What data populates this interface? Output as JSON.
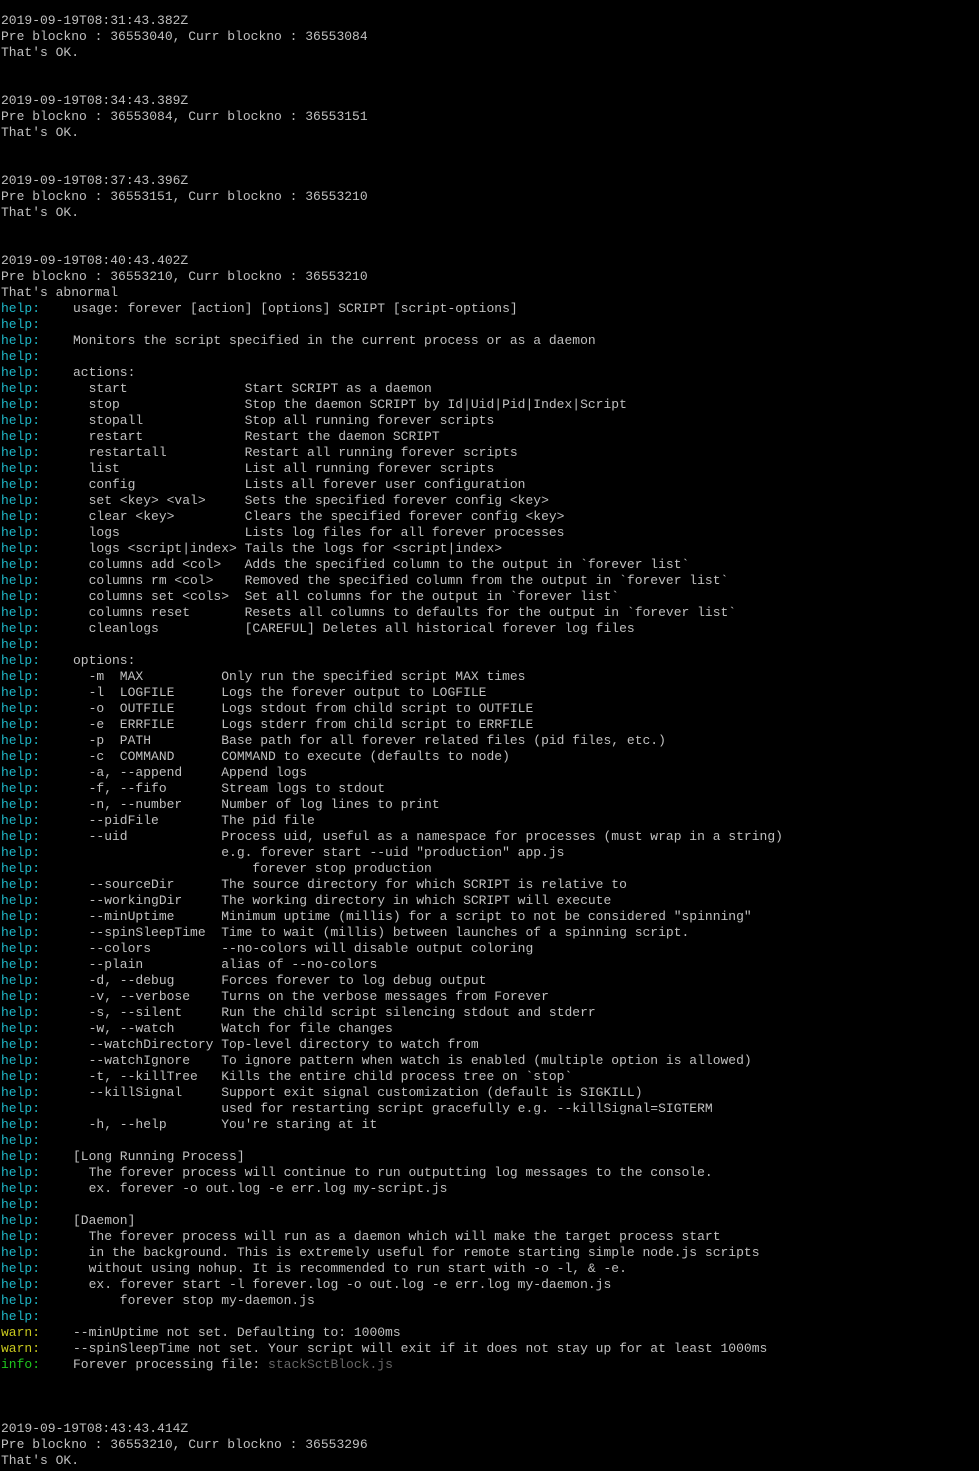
{
  "colors": {
    "background": "#000000",
    "text": "#c0c0c0",
    "help_prefix": "#1eb8c8",
    "warn_prefix": "#c8c81e",
    "info_prefix": "#1ec81e",
    "dim_filename": "#666666"
  },
  "lines": [
    {
      "t": "2019-09-19T08:31:43.382Z"
    },
    {
      "t": "Pre blockno : 36553040, Curr blockno : 36553084"
    },
    {
      "t": "That's OK."
    },
    {
      "t": ""
    },
    {
      "t": ""
    },
    {
      "t": "2019-09-19T08:34:43.389Z"
    },
    {
      "t": "Pre blockno : 36553084, Curr blockno : 36553151"
    },
    {
      "t": "That's OK."
    },
    {
      "t": ""
    },
    {
      "t": ""
    },
    {
      "t": "2019-09-19T08:37:43.396Z"
    },
    {
      "t": "Pre blockno : 36553151, Curr blockno : 36553210"
    },
    {
      "t": "That's OK."
    },
    {
      "t": ""
    },
    {
      "t": ""
    },
    {
      "t": "2019-09-19T08:40:43.402Z"
    },
    {
      "t": "Pre blockno : 36553210, Curr blockno : 36553210"
    },
    {
      "t": "That's abnormal"
    },
    {
      "p": "help:",
      "t": "usage: forever [action] [options] SCRIPT [script-options]"
    },
    {
      "p": "help:",
      "t": ""
    },
    {
      "p": "help:",
      "t": "Monitors the script specified in the current process or as a daemon"
    },
    {
      "p": "help:",
      "t": ""
    },
    {
      "p": "help:",
      "t": "actions:"
    },
    {
      "p": "help:",
      "t": "  start               Start SCRIPT as a daemon"
    },
    {
      "p": "help:",
      "t": "  stop                Stop the daemon SCRIPT by Id|Uid|Pid|Index|Script"
    },
    {
      "p": "help:",
      "t": "  stopall             Stop all running forever scripts"
    },
    {
      "p": "help:",
      "t": "  restart             Restart the daemon SCRIPT"
    },
    {
      "p": "help:",
      "t": "  restartall          Restart all running forever scripts"
    },
    {
      "p": "help:",
      "t": "  list                List all running forever scripts"
    },
    {
      "p": "help:",
      "t": "  config              Lists all forever user configuration"
    },
    {
      "p": "help:",
      "t": "  set <key> <val>     Sets the specified forever config <key>"
    },
    {
      "p": "help:",
      "t": "  clear <key>         Clears the specified forever config <key>"
    },
    {
      "p": "help:",
      "t": "  logs                Lists log files for all forever processes"
    },
    {
      "p": "help:",
      "t": "  logs <script|index> Tails the logs for <script|index>"
    },
    {
      "p": "help:",
      "t": "  columns add <col>   Adds the specified column to the output in `forever list`"
    },
    {
      "p": "help:",
      "t": "  columns rm <col>    Removed the specified column from the output in `forever list`"
    },
    {
      "p": "help:",
      "t": "  columns set <cols>  Set all columns for the output in `forever list`"
    },
    {
      "p": "help:",
      "t": "  columns reset       Resets all columns to defaults for the output in `forever list`"
    },
    {
      "p": "help:",
      "t": "  cleanlogs           [CAREFUL] Deletes all historical forever log files"
    },
    {
      "p": "help:",
      "t": ""
    },
    {
      "p": "help:",
      "t": "options:"
    },
    {
      "p": "help:",
      "t": "  -m  MAX          Only run the specified script MAX times"
    },
    {
      "p": "help:",
      "t": "  -l  LOGFILE      Logs the forever output to LOGFILE"
    },
    {
      "p": "help:",
      "t": "  -o  OUTFILE      Logs stdout from child script to OUTFILE"
    },
    {
      "p": "help:",
      "t": "  -e  ERRFILE      Logs stderr from child script to ERRFILE"
    },
    {
      "p": "help:",
      "t": "  -p  PATH         Base path for all forever related files (pid files, etc.)"
    },
    {
      "p": "help:",
      "t": "  -c  COMMAND      COMMAND to execute (defaults to node)"
    },
    {
      "p": "help:",
      "t": "  -a, --append     Append logs"
    },
    {
      "p": "help:",
      "t": "  -f, --fifo       Stream logs to stdout"
    },
    {
      "p": "help:",
      "t": "  -n, --number     Number of log lines to print"
    },
    {
      "p": "help:",
      "t": "  --pidFile        The pid file"
    },
    {
      "p": "help:",
      "t": "  --uid            Process uid, useful as a namespace for processes (must wrap in a string)"
    },
    {
      "p": "help:",
      "t": "                   e.g. forever start --uid \"production\" app.js"
    },
    {
      "p": "help:",
      "t": "                       forever stop production"
    },
    {
      "p": "help:",
      "t": "  --sourceDir      The source directory for which SCRIPT is relative to"
    },
    {
      "p": "help:",
      "t": "  --workingDir     The working directory in which SCRIPT will execute"
    },
    {
      "p": "help:",
      "t": "  --minUptime      Minimum uptime (millis) for a script to not be considered \"spinning\""
    },
    {
      "p": "help:",
      "t": "  --spinSleepTime  Time to wait (millis) between launches of a spinning script."
    },
    {
      "p": "help:",
      "t": "  --colors         --no-colors will disable output coloring"
    },
    {
      "p": "help:",
      "t": "  --plain          alias of --no-colors"
    },
    {
      "p": "help:",
      "t": "  -d, --debug      Forces forever to log debug output"
    },
    {
      "p": "help:",
      "t": "  -v, --verbose    Turns on the verbose messages from Forever"
    },
    {
      "p": "help:",
      "t": "  -s, --silent     Run the child script silencing stdout and stderr"
    },
    {
      "p": "help:",
      "t": "  -w, --watch      Watch for file changes"
    },
    {
      "p": "help:",
      "t": "  --watchDirectory Top-level directory to watch from"
    },
    {
      "p": "help:",
      "t": "  --watchIgnore    To ignore pattern when watch is enabled (multiple option is allowed)"
    },
    {
      "p": "help:",
      "t": "  -t, --killTree   Kills the entire child process tree on `stop`"
    },
    {
      "p": "help:",
      "t": "  --killSignal     Support exit signal customization (default is SIGKILL)"
    },
    {
      "p": "help:",
      "t": "                   used for restarting script gracefully e.g. --killSignal=SIGTERM"
    },
    {
      "p": "help:",
      "t": "  -h, --help       You're staring at it"
    },
    {
      "p": "help:",
      "t": ""
    },
    {
      "p": "help:",
      "t": "[Long Running Process]"
    },
    {
      "p": "help:",
      "t": "  The forever process will continue to run outputting log messages to the console."
    },
    {
      "p": "help:",
      "t": "  ex. forever -o out.log -e err.log my-script.js"
    },
    {
      "p": "help:",
      "t": ""
    },
    {
      "p": "help:",
      "t": "[Daemon]"
    },
    {
      "p": "help:",
      "t": "  The forever process will run as a daemon which will make the target process start"
    },
    {
      "p": "help:",
      "t": "  in the background. This is extremely useful for remote starting simple node.js scripts"
    },
    {
      "p": "help:",
      "t": "  without using nohup. It is recommended to run start with -o -l, & -e."
    },
    {
      "p": "help:",
      "t": "  ex. forever start -l forever.log -o out.log -e err.log my-daemon.js"
    },
    {
      "p": "help:",
      "t": "      forever stop my-daemon.js"
    },
    {
      "p": "help:",
      "t": ""
    },
    {
      "p": "warn:",
      "t": "--minUptime not set. Defaulting to: 1000ms"
    },
    {
      "p": "warn:",
      "t": "--spinSleepTime not set. Your script will exit if it does not stay up for at least 1000ms"
    },
    {
      "p": "info:",
      "t": "Forever processing file: ",
      "dim": "stackSctBlock.js"
    },
    {
      "t": ""
    },
    {
      "t": ""
    },
    {
      "t": ""
    },
    {
      "t": "2019-09-19T08:43:43.414Z"
    },
    {
      "t": "Pre blockno : 36553210, Curr blockno : 36553296"
    },
    {
      "t": "That's OK."
    }
  ]
}
